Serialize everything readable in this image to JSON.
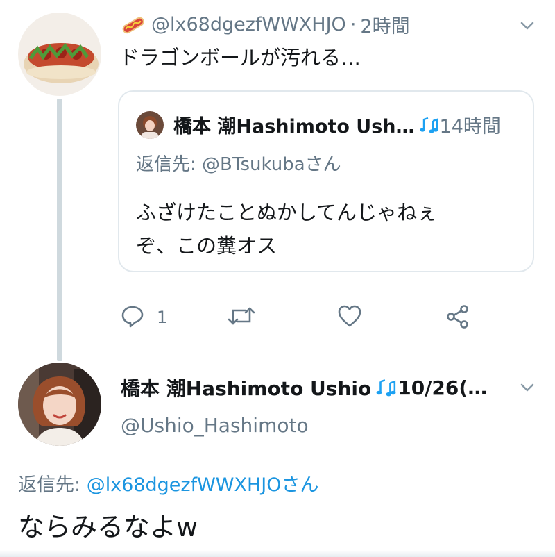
{
  "tweet1": {
    "handle": "@lx68dgezfWWXHJO",
    "separator": "·",
    "time": "2時間",
    "text": "ドラゴンボールが汚れる…"
  },
  "quoted_tweet": {
    "name": "橋本 潮Hashimoto Ush…",
    "time": "14時間",
    "reply_prefix": "返信先: ",
    "reply_handle": "@BTsukubaさん",
    "text_line1": "ふざけたことぬかしてんじゃねぇ",
    "text_line2": "ぞ、この糞オス"
  },
  "actions": {
    "reply_count": "1"
  },
  "tweet2": {
    "name": "橋本 潮Hashimoto Ushio",
    "time": "10/26(…",
    "handle": "@Ushio_Hashimoto",
    "reply_prefix": "返信先: ",
    "reply_handle": "@lx68dgezfWWXHJOさん",
    "text": "ならみるなよw"
  },
  "icons": {
    "emoji": "hotdog-icon",
    "name_badge": "music-notes-icon",
    "chevron": "chevron-down-icon",
    "reply": "reply-icon",
    "retweet": "retweet-icon",
    "like": "heart-icon",
    "share": "share-icon"
  },
  "colors": {
    "text": "#14171a",
    "muted": "#657786",
    "link": "#1b95e0",
    "border": "#e1e8ed",
    "badge": "#1da1f2"
  }
}
